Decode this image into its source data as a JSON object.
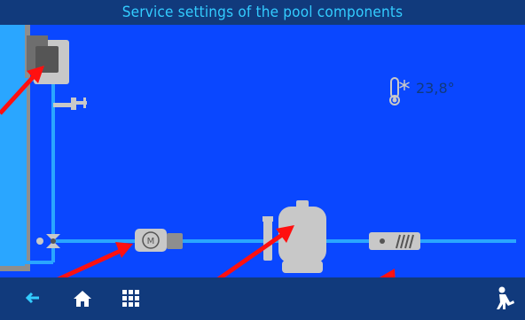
{
  "header": {
    "title": "Service settings of the pool components"
  },
  "sensor": {
    "temperature": "23,8°",
    "icon": "thermometer-snowflake-icon"
  },
  "components": {
    "heat_pump": {
      "icon": "heat-pump-icon"
    },
    "tap": {
      "icon": "tap-icon"
    },
    "valve": {
      "icon": "three-way-valve-icon"
    },
    "pump": {
      "icon": "pump-motor-icon",
      "motor_label": "M"
    },
    "filter": {
      "icon": "sand-filter-icon"
    },
    "heater": {
      "icon": "electric-heater-icon"
    }
  },
  "nav": {
    "back": {
      "icon": "back-arrow-icon"
    },
    "home": {
      "icon": "home-icon"
    },
    "menu": {
      "icon": "grid-menu-icon"
    },
    "service": {
      "icon": "service-worker-icon"
    }
  },
  "colors": {
    "background": "#0a47ff",
    "bars": "#113a7c",
    "pipe": "#2aa6ff",
    "title_text": "#33ccff",
    "component": "#c8c8c8",
    "pointer_arrows": "#ff1010"
  }
}
